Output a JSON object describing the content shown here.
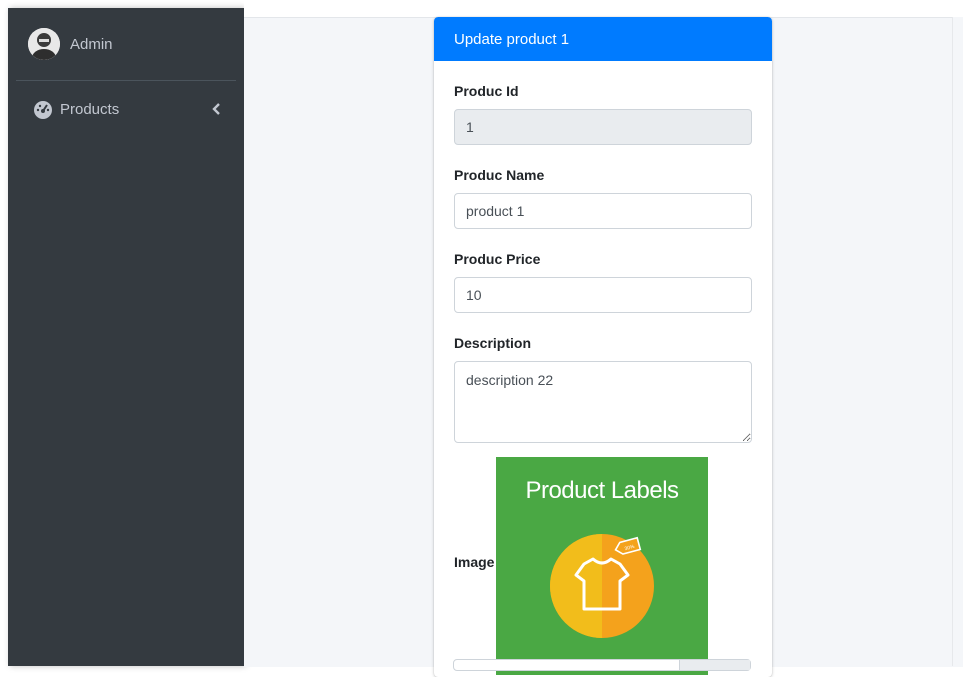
{
  "sidebar": {
    "user": {
      "name": "Admin"
    },
    "nav": [
      {
        "label": "Products",
        "icon": "dashboard-gauge-icon"
      }
    ]
  },
  "card": {
    "title": "Update product 1",
    "fields": {
      "id": {
        "label": "Produc Id",
        "value": "1"
      },
      "name": {
        "label": "Produc Name",
        "value": "product 1"
      },
      "price": {
        "label": "Produc Price",
        "value": "10"
      },
      "description": {
        "label": "Description",
        "value": "description 22"
      },
      "image": {
        "label": "Image",
        "image_text": "Product Labels",
        "tag_text": "30%"
      }
    }
  },
  "colors": {
    "sidebar_bg": "#343a40",
    "header_blue": "#007bff",
    "image_green": "#4aa844",
    "badge_orange": "#f4a21c",
    "badge_yellow": "#f2bd1b"
  }
}
